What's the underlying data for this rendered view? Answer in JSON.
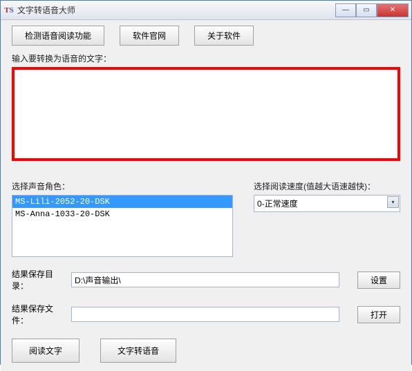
{
  "window": {
    "title": "文字转语音大师"
  },
  "toolbar": {
    "detect": "检测语音阅读功能",
    "website": "软件官网",
    "about": "关于软件"
  },
  "input_label": "输入要转换为语音的文字：",
  "voice_label": "选择声音角色：",
  "speed_label": "选择阅读速度(值越大语速越快)：",
  "voices": {
    "items": [
      "MS-Lili-2052-20-DSK",
      "MS-Anna-1033-20-DSK"
    ]
  },
  "speed_value": "0-正常速度",
  "save_dir_label": "结果保存目录：",
  "save_dir_value": "D:\\声音输出\\",
  "save_file_label": "结果保存文件：",
  "save_file_value": "",
  "btn_settings": "设置",
  "btn_open": "打开",
  "btn_read": "阅读文字",
  "btn_convert": "文字转语音"
}
